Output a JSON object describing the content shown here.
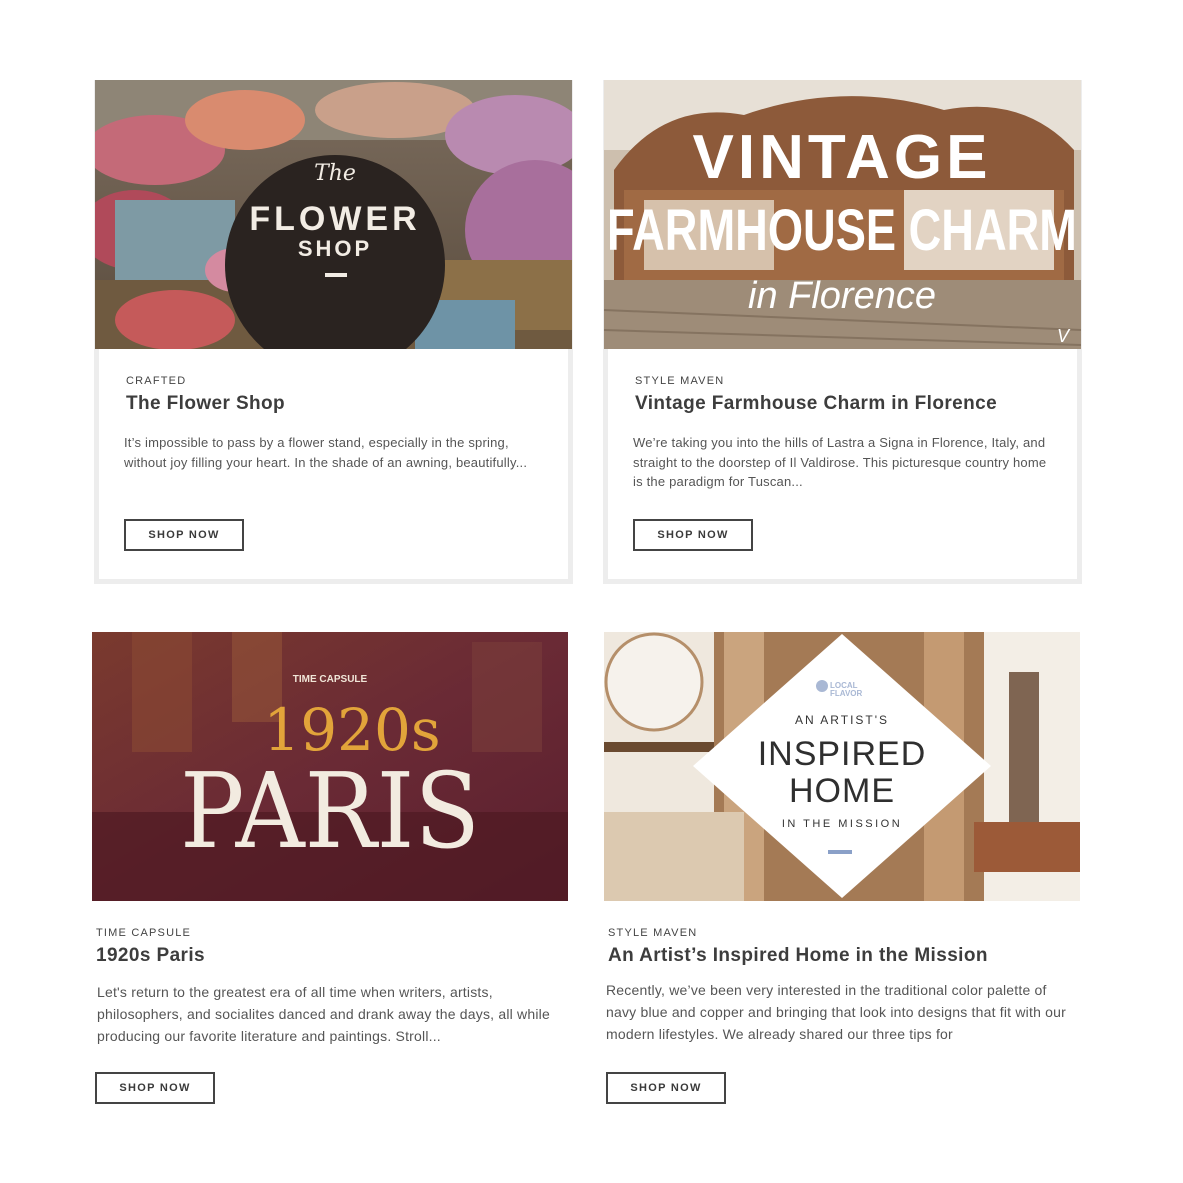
{
  "cards": [
    {
      "eyebrow": "CRAFTED",
      "title": "The Flower Shop",
      "excerpt": "It’s impossible to pass by a flower stand, especially in the spring, without joy filling your heart. In the shade of an awning, beautifully...",
      "button": "SHOP NOW",
      "image": {
        "small_text": "The",
        "line1": "FLOWER",
        "line2": "SHOP"
      }
    },
    {
      "eyebrow": "STYLE MAVEN",
      "title": "Vintage Farmhouse Charm in Florence",
      "excerpt": "We’re taking you into the hills of Lastra a Signa in Florence, Italy, and straight to the doorstep of Il Valdirose. This picturesque country home is the paradigm for Tuscan...",
      "button": "SHOP NOW",
      "image": {
        "line1": "VINTAGE",
        "line2": "FARMHOUSE CHARM",
        "line3": "in Florence",
        "corner_mark": "V"
      }
    },
    {
      "eyebrow": "TIME CAPSULE",
      "title": "1920s Paris",
      "excerpt": "Let's return to the greatest era of all time when writers, artists, philosophers, and socialites danced and drank away the days, all while producing our favorite literature and paintings. Stroll...",
      "button": "SHOP NOW",
      "image": {
        "badge": "TIME CAPSULE",
        "line1": "1920s",
        "line2": "PARIS"
      }
    },
    {
      "eyebrow": "STYLE MAVEN",
      "title": "An Artist’s Inspired Home in the Mission",
      "excerpt": "Recently, we’ve been very interested in the traditional color palette of navy blue and copper and bringing that look into designs that fit with our modern lifestyles. We already shared our three tips for",
      "button": "SHOP NOW",
      "image": {
        "badge_line1": "LOCAL",
        "badge_line2": "FLAVOR",
        "line1": "AN ARTIST'S",
        "line2": "INSPIRED",
        "line3": "HOME",
        "line4": "IN THE MISSION"
      }
    }
  ],
  "colors": {
    "frame": "#ededed",
    "button_border": "#444444",
    "paris_gold": "#e2a43a",
    "accent_blue": "#8aa0c8"
  }
}
